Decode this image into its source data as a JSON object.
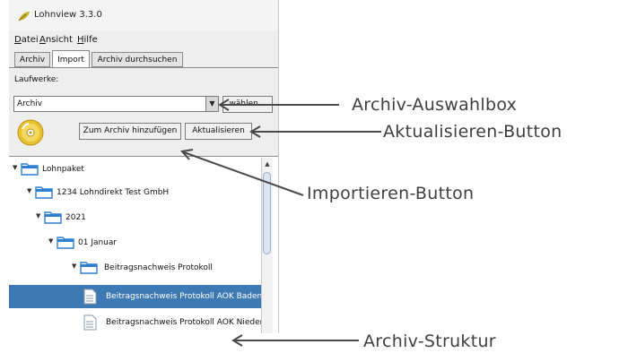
{
  "window": {
    "title": "Lohnview 3.3.0",
    "menu": [
      "Datei",
      "Ansicht",
      "Hilfe"
    ],
    "tabs": [
      "Archiv",
      "Import",
      "Archiv durchsuchen"
    ],
    "active_tab": "Import"
  },
  "import_panel": {
    "drives_label": "Laufwerke:",
    "archive_select": {
      "value": "Archiv"
    },
    "choose_button": "wählen...",
    "add_button": "Zum Archiv hinzufügen",
    "refresh_button": "Aktualisieren"
  },
  "tree": [
    {
      "label": "Lohnpaket",
      "type": "folder",
      "expanded": true
    },
    {
      "label": "1234 Lohndirekt Test GmbH",
      "type": "folder",
      "expanded": true
    },
    {
      "label": "2021",
      "type": "folder",
      "expanded": true
    },
    {
      "label": "01 Januar",
      "type": "folder",
      "expanded": true
    },
    {
      "label": "Beitragsnachweis Protokoll",
      "type": "folder",
      "expanded": true
    },
    {
      "label": "Beitragsnachweis Protokoll AOK Baden",
      "type": "file",
      "selected": true
    },
    {
      "label": "Beitragsnachweis Protokoll AOK Nieder",
      "type": "file",
      "selected": false
    }
  ],
  "callouts": {
    "archive_select": "Archiv-Auswahlbox",
    "refresh_button": "Aktualisieren-Button",
    "import_button": "Importieren-Button",
    "archive_structure": "Archiv-Struktur"
  },
  "colors": {
    "selection": "#3d7ab3",
    "folder": "#2f7fd1",
    "annotation": "#3f3f3f"
  }
}
